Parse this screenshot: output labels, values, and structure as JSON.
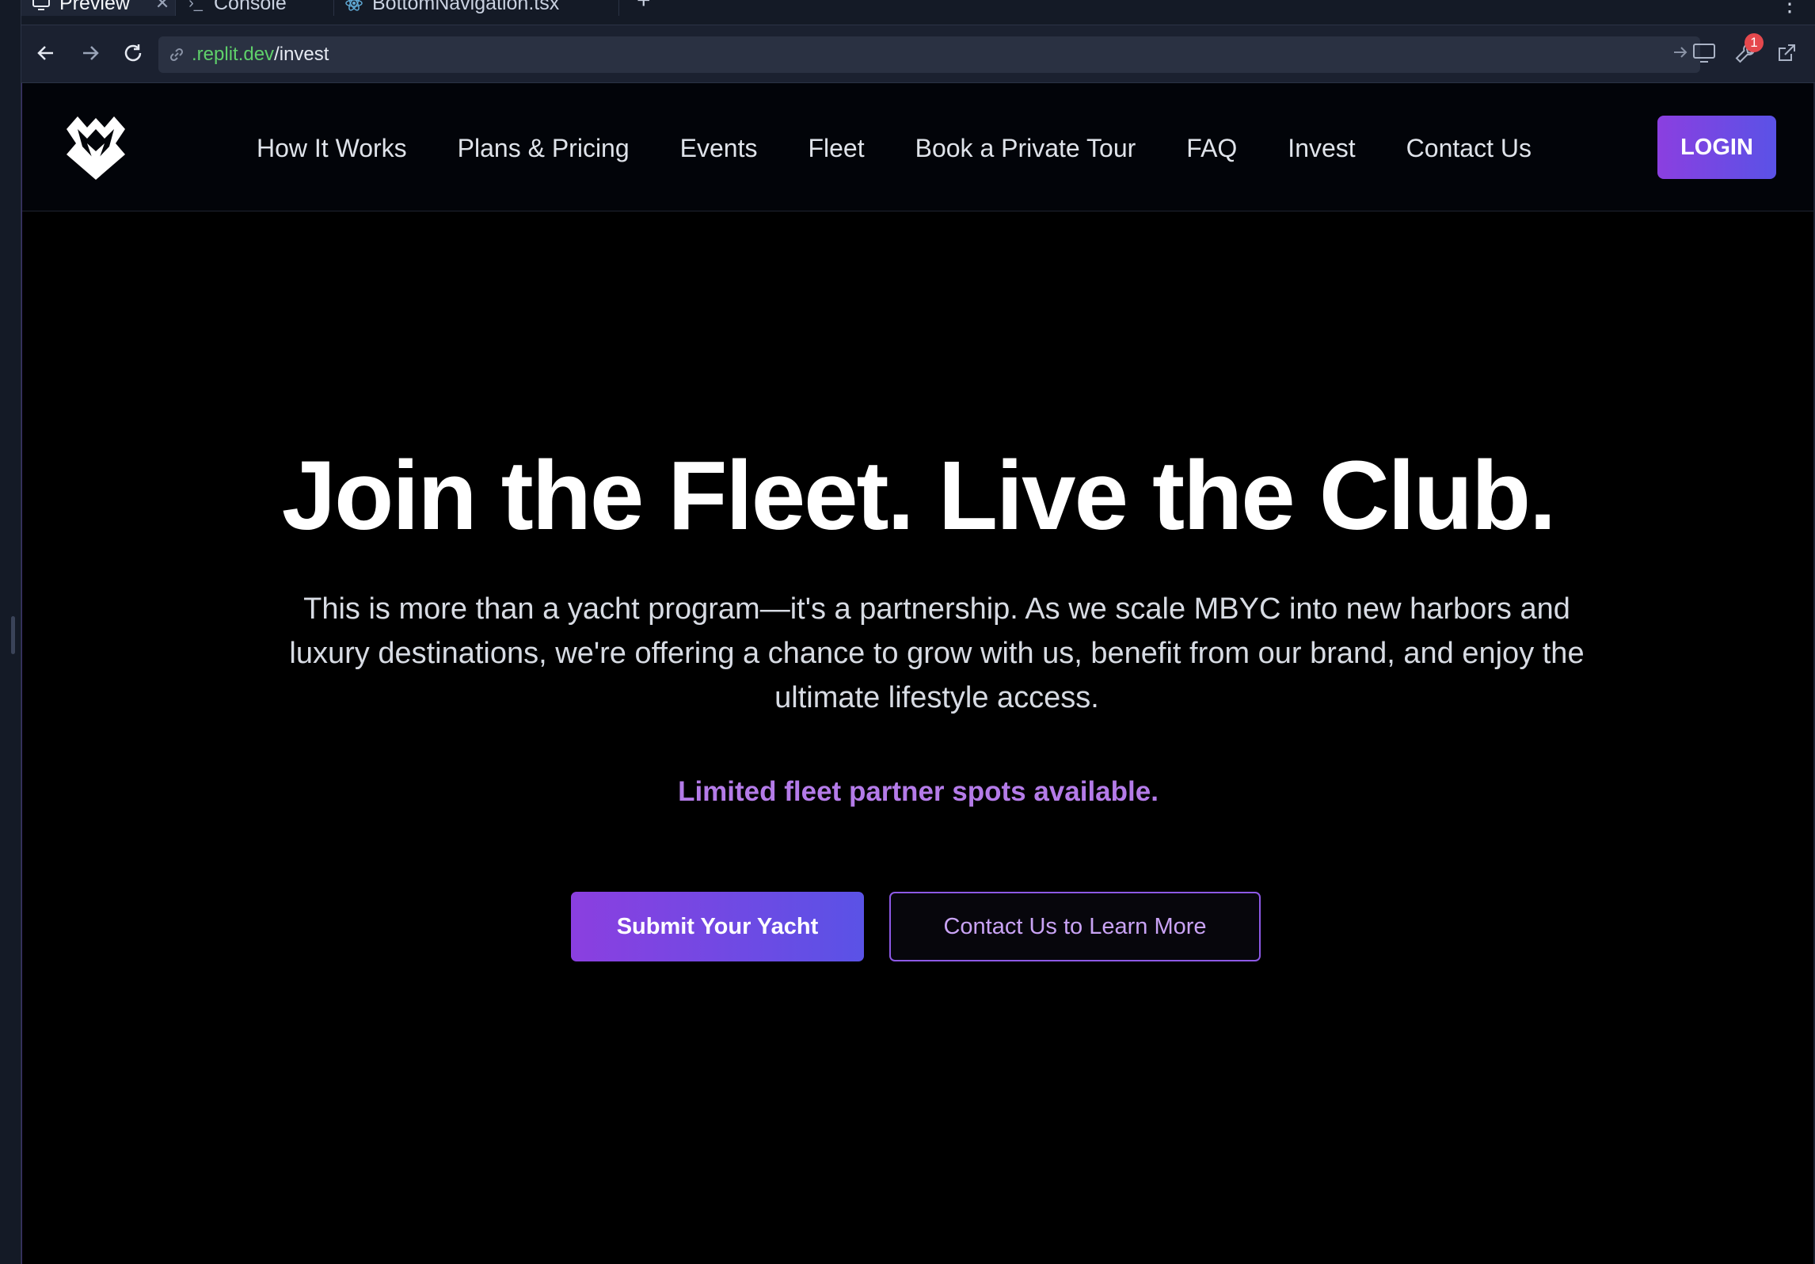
{
  "tabs": [
    {
      "label": "Preview",
      "icon": "monitor-icon",
      "active": true
    },
    {
      "label": "Console",
      "icon": "terminal-icon",
      "active": false
    },
    {
      "label": "BottomNavigation.tsx",
      "icon": "react-icon",
      "active": false
    }
  ],
  "url": {
    "host": ".replit.dev",
    "path": "/invest"
  },
  "chrome_badge": "1",
  "site": {
    "logo": "mbyc-logo-icon",
    "nav": [
      "How It Works",
      "Plans & Pricing",
      "Events",
      "Fleet",
      "Book a Private Tour",
      "FAQ",
      "Invest",
      "Contact Us"
    ],
    "login_label": "LOGIN"
  },
  "hero": {
    "title": "Join the Fleet. Live the Club.",
    "subtitle": "This is more than a yacht program—it's a partnership. As we scale MBYC into new harbors and luxury destinations, we're offering a chance to grow with us, benefit from our brand, and enjoy the ultimate lifestyle access.",
    "note": "Limited fleet partner spots available.",
    "primary_cta": "Submit Your Yacht",
    "secondary_cta": "Contact Us to Learn More"
  },
  "colors": {
    "accent_purple": "#8b3fe0",
    "accent_indigo": "#5a52e6",
    "note_purple": "#b47be8",
    "url_green": "#5fd06a"
  }
}
